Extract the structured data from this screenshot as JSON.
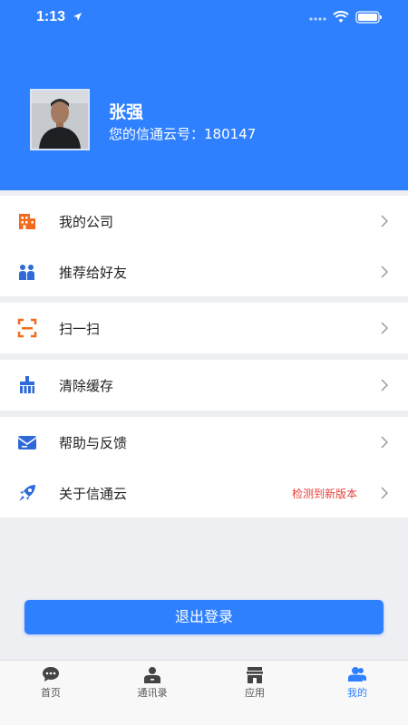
{
  "status_bar": {
    "time": "1:13"
  },
  "profile": {
    "name": "张强",
    "id_line": "您的信通云号：180147"
  },
  "menu_groups": [
    {
      "items": [
        {
          "label": "我的公司",
          "icon": "building-icon"
        },
        {
          "label": "推荐给好友",
          "icon": "share-friends-icon"
        }
      ]
    },
    {
      "items": [
        {
          "label": "扫一扫",
          "icon": "scan-icon"
        }
      ]
    },
    {
      "items": [
        {
          "label": "清除缓存",
          "icon": "broom-icon"
        }
      ]
    },
    {
      "items": [
        {
          "label": "帮助与反馈",
          "icon": "mail-feedback-icon"
        },
        {
          "label": "关于信通云",
          "icon": "rocket-icon",
          "badge": "检测到新版本"
        }
      ]
    }
  ],
  "logout": {
    "label": "退出登录"
  },
  "tabs": [
    {
      "label": "首页",
      "icon": "chat-icon",
      "active": false
    },
    {
      "label": "通讯录",
      "icon": "contacts-icon",
      "active": false
    },
    {
      "label": "应用",
      "icon": "store-icon",
      "active": false
    },
    {
      "label": "我的",
      "icon": "profile-icon",
      "active": true
    }
  ],
  "colors": {
    "primary": "#2f80ff",
    "icon_orange": "#f26b1d",
    "icon_blue": "#2f6ad8",
    "alert_red": "#e6403a"
  }
}
